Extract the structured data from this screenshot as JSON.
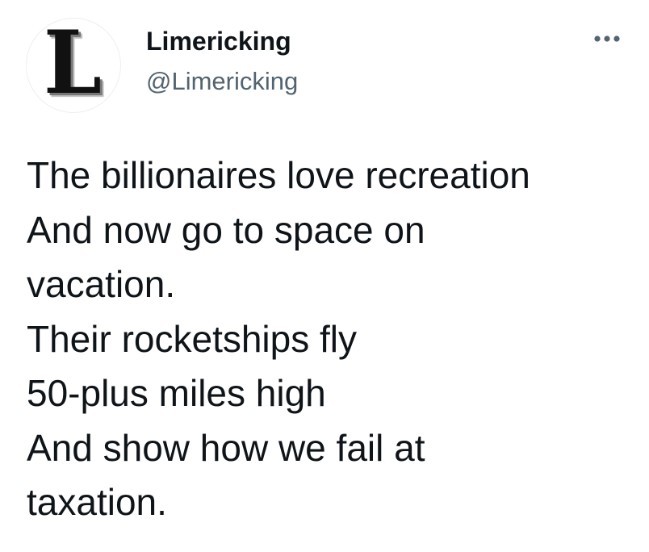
{
  "author": {
    "display_name": "Limericking",
    "handle": "@Limericking",
    "avatar_letter": "L"
  },
  "more_icon": "more-horizontal-icon",
  "tweet": {
    "lines": [
      "The billionaires love recreation",
      "And now go to space on",
      "vacation.",
      "Their rocketships fly",
      "50-plus miles high",
      "And show how we fail at",
      "taxation."
    ]
  },
  "colors": {
    "text": "#0f1419",
    "secondary": "#536471",
    "background": "#ffffff"
  }
}
